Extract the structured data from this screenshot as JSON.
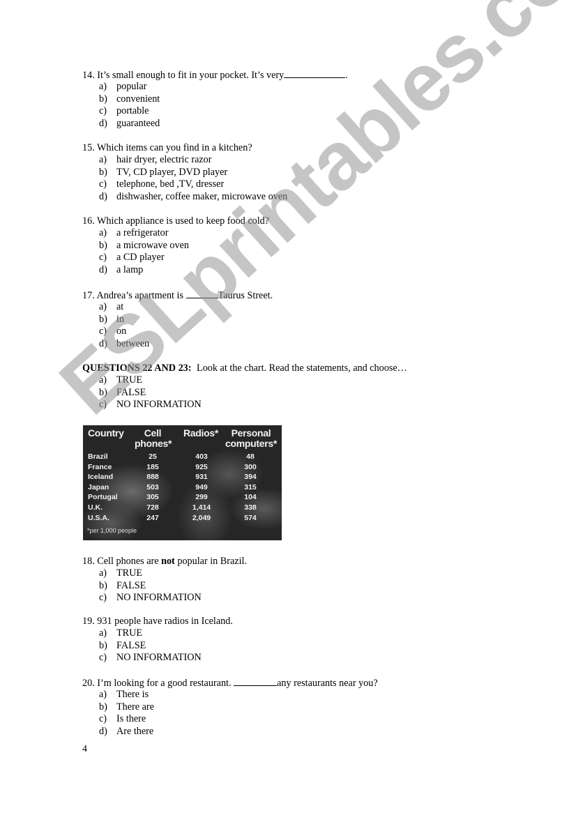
{
  "questions": [
    {
      "number": "14.",
      "stem_before": "It’s small enough to fit in your pocket. It’s very",
      "stem_after": ".",
      "options": [
        {
          "letter": "a)",
          "text": "popular"
        },
        {
          "letter": "b)",
          "text": "convenient"
        },
        {
          "letter": "c)",
          "text": "portable"
        },
        {
          "letter": "d)",
          "text": "guaranteed"
        }
      ]
    },
    {
      "number": "15.",
      "stem": "Which items can you find in a kitchen?",
      "options": [
        {
          "letter": "a)",
          "text": "hair dryer, electric razor"
        },
        {
          "letter": "b)",
          "text": "TV, CD player, DVD player"
        },
        {
          "letter": "c)",
          "text": "telephone, bed ,TV, dresser"
        },
        {
          "letter": "d)",
          "text": "dishwasher, coffee maker, microwave oven"
        }
      ]
    },
    {
      "number": "16.",
      "stem": "Which appliance is used to keep food cold?",
      "options": [
        {
          "letter": "a)",
          "text": "a refrigerator"
        },
        {
          "letter": "b)",
          "text": "a microwave oven"
        },
        {
          "letter": "c)",
          "text": "a CD player"
        },
        {
          "letter": "d)",
          "text": "a lamp"
        }
      ]
    },
    {
      "number": "17.",
      "stem_before": "Andrea’s apartment is",
      "stem_after": "Taurus Street.",
      "options": [
        {
          "letter": "a)",
          "text": "at"
        },
        {
          "letter": "b)",
          "text": "in"
        },
        {
          "letter": "c)",
          "text": "on"
        },
        {
          "letter": "d)",
          "text": "between"
        }
      ]
    }
  ],
  "section": {
    "heading": "QUESTIONS 22 AND 23:",
    "instruction": "Look at the chart.  Read the statements, and choose…",
    "options": [
      {
        "letter": "a)",
        "text": "TRUE"
      },
      {
        "letter": "b)",
        "text": "FALSE"
      },
      {
        "letter": "c)",
        "text": "NO INFORMATION"
      }
    ]
  },
  "chart_table": {
    "headers": [
      [
        "Country"
      ],
      [
        "Cell",
        "phones*"
      ],
      [
        "Radios*"
      ],
      [
        "Personal",
        "computers*"
      ]
    ],
    "rows": [
      [
        "Brazil",
        "25",
        "403",
        "48"
      ],
      [
        "France",
        "185",
        "925",
        "300"
      ],
      [
        "Iceland",
        "888",
        "931",
        "394"
      ],
      [
        "Japan",
        "503",
        "949",
        "315"
      ],
      [
        "Portugal",
        "305",
        "299",
        "104"
      ],
      [
        "U.K.",
        "728",
        "1,414",
        "338"
      ],
      [
        "U.S.A.",
        "247",
        "2,049",
        "574"
      ]
    ],
    "footnote": "*per 1,000 people"
  },
  "q18": {
    "number": "18.",
    "stem_before": "Cell phones are",
    "stem_bold": "not",
    "stem_after": "popular in Brazil.",
    "options": [
      {
        "letter": "a)",
        "text": "TRUE"
      },
      {
        "letter": "b)",
        "text": "FALSE"
      },
      {
        "letter": "c)",
        "text": "NO INFORMATION"
      }
    ]
  },
  "q19": {
    "number": "19.",
    "stem": "931 people have radios in Iceland.",
    "options": [
      {
        "letter": "a)",
        "text": "TRUE"
      },
      {
        "letter": "b)",
        "text": "FALSE"
      },
      {
        "letter": "c)",
        "text": "NO INFORMATION"
      }
    ]
  },
  "q20": {
    "number": "20.",
    "stem_before": "I’m looking for a good restaurant.",
    "stem_after": "any restaurants near you?",
    "options": [
      {
        "letter": "a)",
        "text": "There is"
      },
      {
        "letter": "b)",
        "text": "There are"
      },
      {
        "letter": "c)",
        "text": "Is there"
      },
      {
        "letter": "d)",
        "text": "Are there"
      }
    ]
  },
  "page_number": "4",
  "watermark": "ESLprintables.com"
}
